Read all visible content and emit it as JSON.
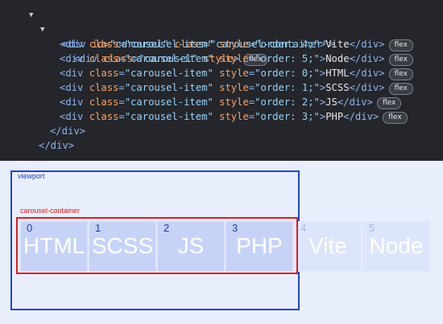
{
  "devtools": {
    "carousel_open": "<div id=\"carousel\" class=\"carousel-container\">",
    "inner_open": "<div class=\"carousel\" style>",
    "inner_badge": "flex",
    "items": [
      {
        "prefix": "<div class=\"carousel-item\" style=\"order: 4;\">",
        "text": "Vite",
        "suffix": "</div>",
        "badge": "flex"
      },
      {
        "prefix": "<div class=\"carousel-item\" style=\"order: 5;\">",
        "text": "Node",
        "suffix": "</div>",
        "badge": "flex"
      },
      {
        "prefix": "<div class=\"carousel-item\" style=\"order: 0;\">",
        "text": "HTML",
        "suffix": "</div>",
        "badge": "flex"
      },
      {
        "prefix": "<div class=\"carousel-item\" style=\"order: 1;\">",
        "text": "SCSS",
        "suffix": "</div>",
        "badge": "flex"
      },
      {
        "prefix": "<div class=\"carousel-item\" style=\"order: 2;\">",
        "text": "JS",
        "suffix": "</div>",
        "badge": "flex"
      },
      {
        "prefix": "<div class=\"carousel-item\" style=\"order: 3;\">",
        "text": "PHP",
        "suffix": "</div>",
        "badge": "flex"
      }
    ],
    "close_inner": "</div>",
    "close_outer": "</div>"
  },
  "preview": {
    "viewport_label": "viewport",
    "container_label": "carousel-container",
    "cards": [
      {
        "index": "0",
        "name": "HTML"
      },
      {
        "index": "1",
        "name": "SCSS"
      },
      {
        "index": "2",
        "name": "JS"
      },
      {
        "index": "3",
        "name": "PHP"
      },
      {
        "index": "4",
        "name": "Vite"
      },
      {
        "index": "5",
        "name": "Node"
      }
    ]
  },
  "colors": {
    "viewport_border": "#1d46d1",
    "container_border": "#e01b1b",
    "card_fill": "#c7d3f6"
  }
}
